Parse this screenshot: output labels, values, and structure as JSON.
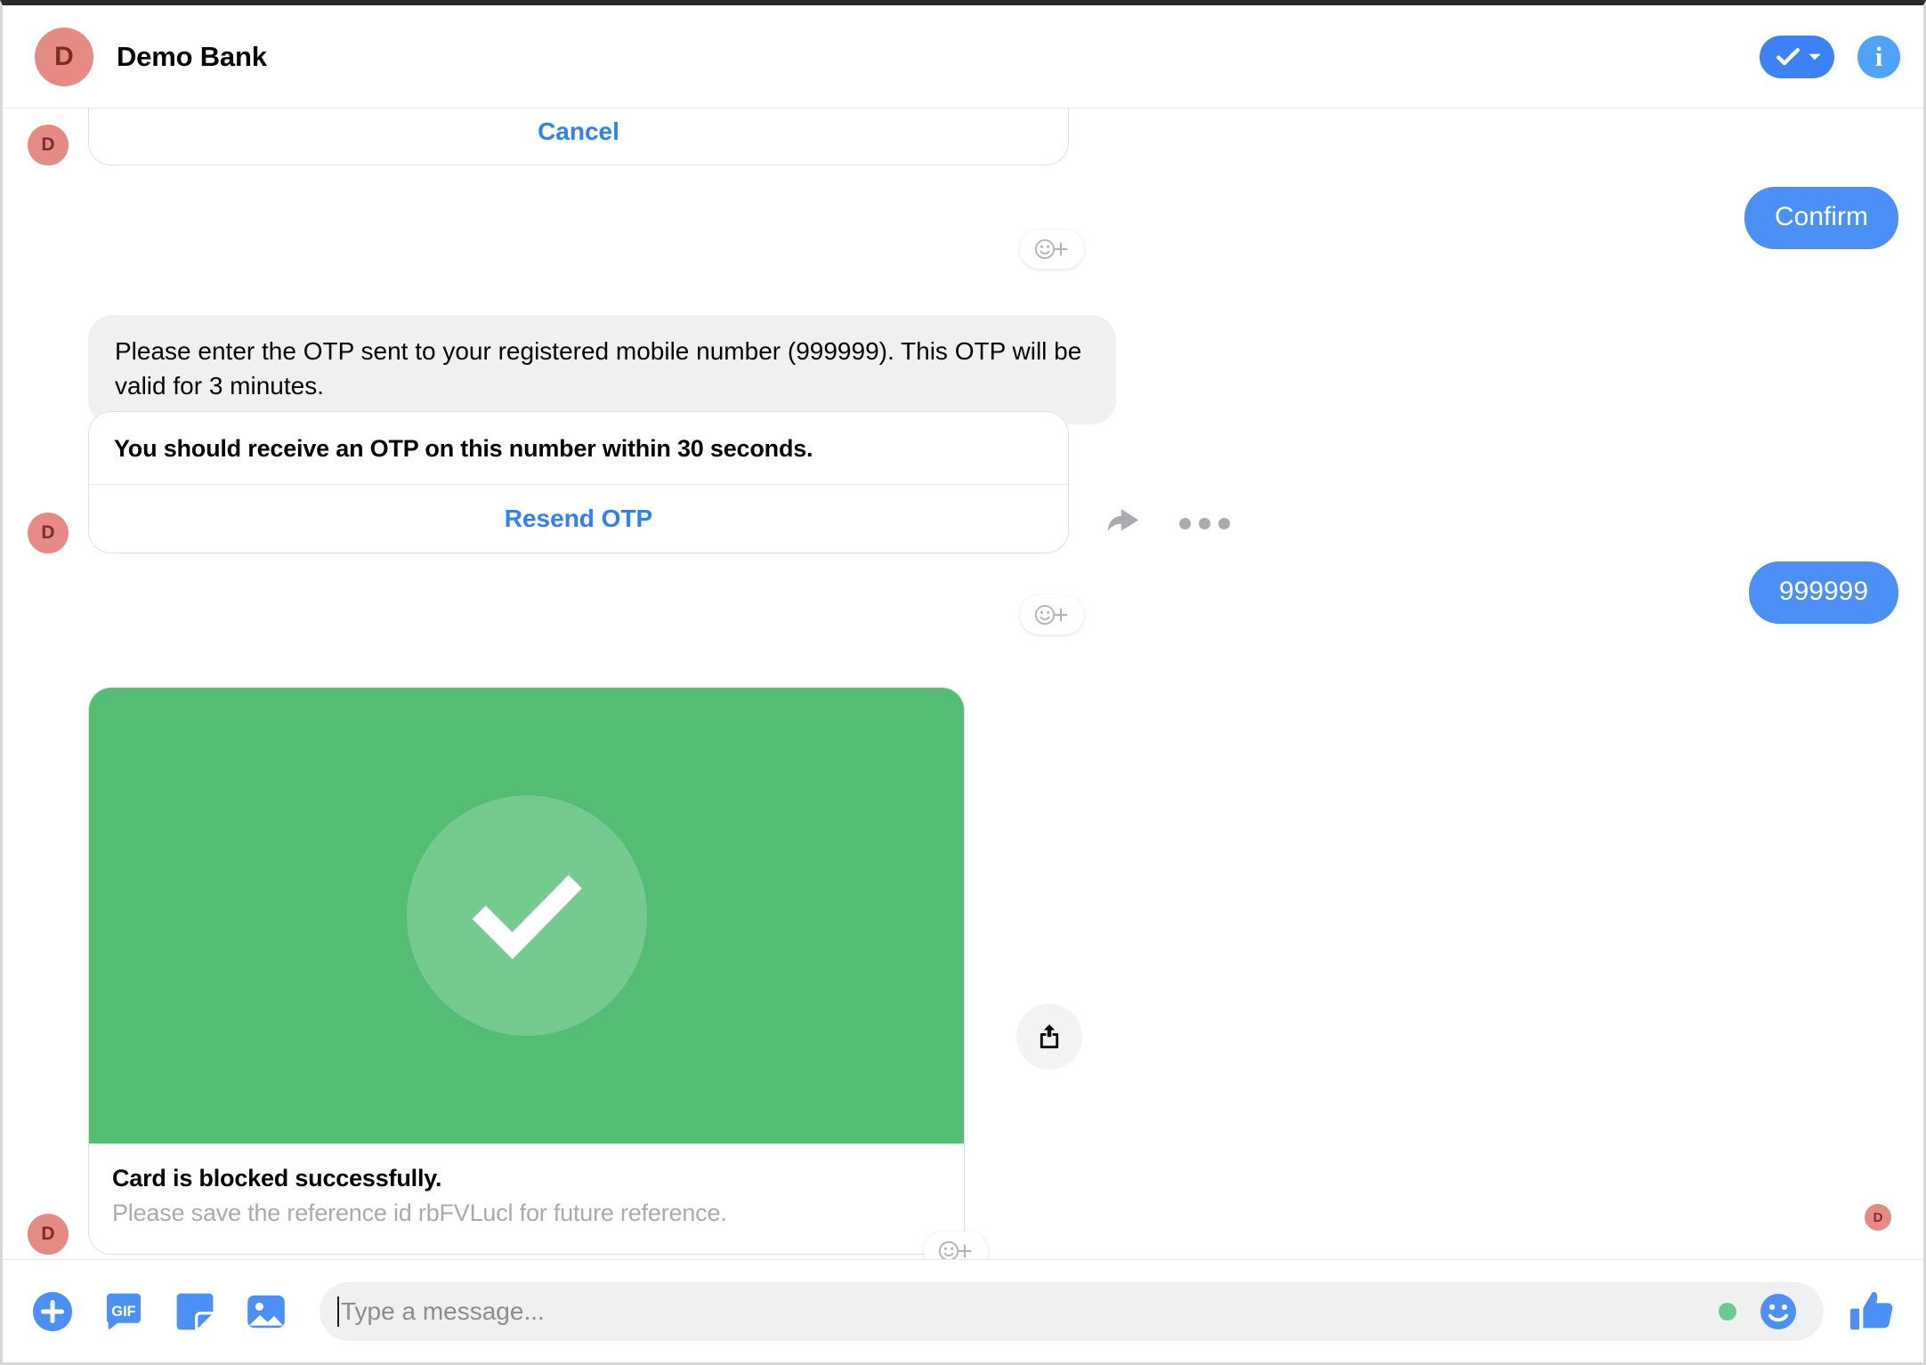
{
  "header": {
    "avatar_initial": "D",
    "title": "Demo Bank",
    "check_pill_name": "message-status-pill",
    "info_label": "i"
  },
  "thread": {
    "avatar_initial": "D",
    "messages": [
      {
        "id": "cancel-card",
        "type": "card-cut-off",
        "button_label": "Cancel"
      },
      {
        "id": "confirm-sent",
        "type": "sent",
        "text": "Confirm"
      },
      {
        "id": "otp-prompt",
        "type": "received-text",
        "text": "Please enter the OTP sent to your registered mobile number (999999). This OTP will be valid for 3 minutes."
      },
      {
        "id": "otp-card",
        "type": "card",
        "title": "You should receive an OTP on this number within 30 seconds.",
        "button_label": "Resend OTP"
      },
      {
        "id": "otp-sent",
        "type": "sent",
        "text": "999999"
      },
      {
        "id": "success-card",
        "type": "media-card",
        "caption_title": "Card is blocked successfully.",
        "caption_subtitle": "Please save the reference id rbFVLucl for future reference.",
        "hero_color": "#53bd74",
        "icon": "check-icon"
      }
    ],
    "seen_avatar_initial": "D"
  },
  "composer": {
    "placeholder": "Type a message...",
    "value": "",
    "gif_label": "GIF",
    "icons": [
      "plus-circle-icon",
      "gif-icon",
      "sticker-icon",
      "photo-icon"
    ],
    "emoji_icon": "smiley-icon",
    "like_icon": "thumbs-up-icon"
  },
  "colors": {
    "accent_blue": "#4a90f7",
    "link_blue": "#2e82f8",
    "success_green": "#53bd74",
    "avatar_pink": "#e58b83",
    "bubble_grey": "#f0f0f0"
  }
}
